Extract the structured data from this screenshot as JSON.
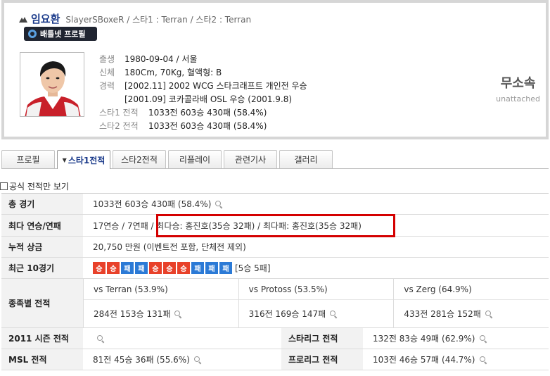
{
  "profile": {
    "name": "임요환",
    "sub_info": "SlayerSBoxeR / 스타1 : Terran / 스타2 : Terran",
    "bnet_button": "배틀넷 프로필",
    "info": [
      {
        "label": "출생",
        "value": "1980-09-04 / 서울"
      },
      {
        "label": "신체",
        "value": "180Cm, 70Kg, 혈액형: B"
      },
      {
        "label": "경력",
        "value": "[2002.11] 2002 WCG 스타크래프트 개인전 우승"
      },
      {
        "label": "",
        "value": "[2001.09] 코카콜라배 OSL 우승 (2001.9.8)"
      },
      {
        "label": "스타1 전적",
        "value": "1033전 603승 430패 (58.4%)"
      },
      {
        "label": "스타2 전적",
        "value": "1033전 603승 430패 (58.4%)"
      }
    ],
    "team_kr": "무소속",
    "team_en": "unattached"
  },
  "tabs": [
    "프로필",
    "스타1전적",
    "스타2전적",
    "리플레이",
    "관련기사",
    "갤러리"
  ],
  "official_only": "공식 전적만 보기",
  "stats": {
    "total_label": "총 경기",
    "total_value": "1033전 603승 430패 (58.4%)",
    "streak_label": "최다 연승/연패",
    "streak_value": "17연승 / 7연패 / 최다승: 홍진호(35승 32패) / 최다패: 홍진호(35승 32패)",
    "prize_label": "누적 상금",
    "prize_value": "20,750 만원 (이벤트전 포함, 단체전 제외)",
    "recent_label": "최근 10경기",
    "recent_results": [
      "승",
      "승",
      "패",
      "패",
      "승",
      "승",
      "승",
      "패",
      "패",
      "패"
    ],
    "recent_summary": "[5승 5패]",
    "race_label": "종족별 전적",
    "race": [
      {
        "head": "vs Terran (53.9%)",
        "value": "284전 153승 131패"
      },
      {
        "head": "vs Protoss (53.5%)",
        "value": "316전 169승 147패"
      },
      {
        "head": "vs Zerg (64.9%)",
        "value": "433전 281승 152패"
      }
    ],
    "season_label": "2011 시즌 전적",
    "season_value": "",
    "starleague_label": "스타리그 전적",
    "starleague_value": "132전 83승 49패 (62.9%)",
    "msl_label": "MSL 전적",
    "msl_value": "81전 45승 36패 (55.6%)",
    "proleague_label": "프로리그 전적",
    "proleague_value": "103전 46승 57패 (44.7%)"
  },
  "colors": {
    "win": "#e8412a",
    "loss": "#2b7ad6",
    "highlight_box": "#d40000",
    "name": "#1a3a8a"
  }
}
